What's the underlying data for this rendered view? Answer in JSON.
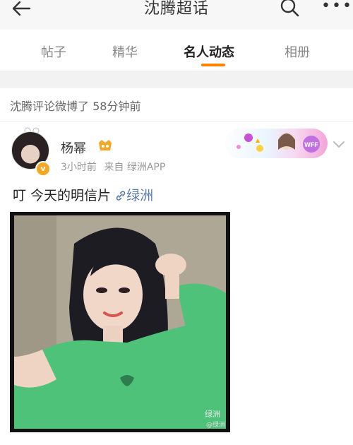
{
  "header": {
    "title": "沈腾超话",
    "more_label": "•••"
  },
  "tabs": [
    {
      "label": "帖子",
      "active": false
    },
    {
      "label": "精华",
      "active": false
    },
    {
      "label": "名人动态",
      "active": true
    },
    {
      "label": "相册",
      "active": false
    }
  ],
  "notice": {
    "text": "沈腾评论微博了 58分钟前"
  },
  "post": {
    "username": "杨幂",
    "time": "3小时前",
    "source": "来自 绿洲APP",
    "text": "叮 今天的明信片",
    "link_text": "绿洲",
    "verified_mark": "v",
    "badge_text": "WFF"
  },
  "photo": {
    "watermark": "绿洲",
    "watermark_sub": "@绿洲"
  },
  "colors": {
    "accent": "#ff8200",
    "link": "#5b7ba8",
    "shirt": "#4fc27a"
  }
}
